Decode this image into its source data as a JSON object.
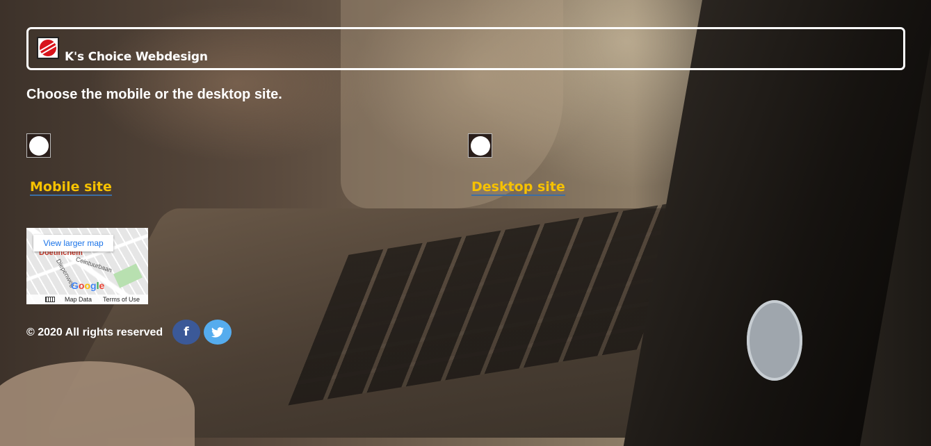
{
  "header": {
    "site_title": "K's Choice Webdesign",
    "logo_icon": "ks-choice-logo-icon"
  },
  "intro_text": "Choose the mobile or the desktop site.",
  "choices": {
    "mobile": {
      "label": "Mobile site",
      "icon": "mobile-circle-icon"
    },
    "desktop": {
      "label": "Desktop site",
      "icon": "desktop-circle-icon"
    }
  },
  "map": {
    "view_larger": "View larger map",
    "town_label": "Doetinchem",
    "street_1": "Ceintuurbaan",
    "street_2": "Diepenweg",
    "google_letters": [
      "G",
      "o",
      "o",
      "g",
      "l",
      "e"
    ],
    "map_data": "Map Data",
    "terms": "Terms of Use"
  },
  "footer": {
    "copyright": "© 2020 All rights reserved",
    "facebook_glyph": "f",
    "twitter_glyph": "🐦"
  },
  "colors": {
    "link": "#f7c200",
    "facebook": "#3b5998",
    "twitter": "#55acee"
  }
}
